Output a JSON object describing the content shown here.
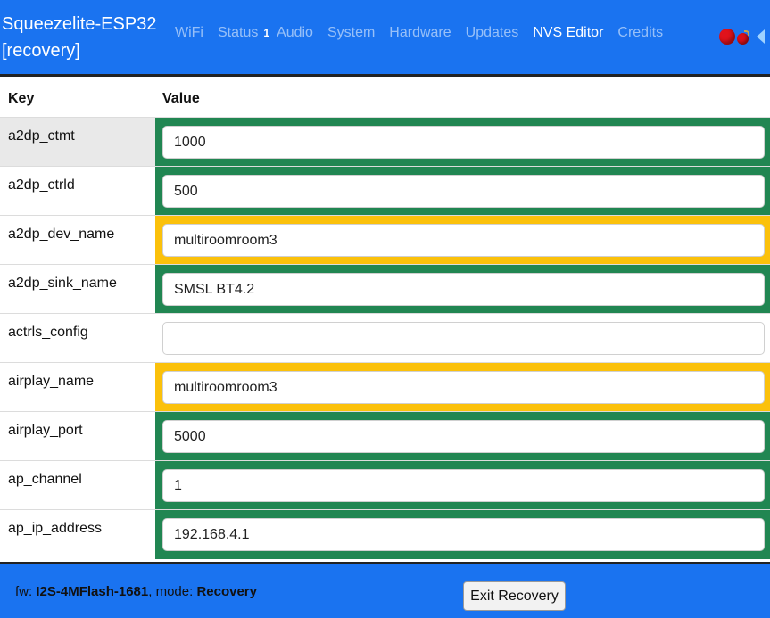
{
  "brand": {
    "line1": "Squeezelite-ESP32",
    "line2": "[recovery]"
  },
  "nav": {
    "wifi": "WiFi",
    "status": "Status",
    "status_badge": "1",
    "audio": "Audio",
    "system": "System",
    "hardware": "Hardware",
    "updates": "Updates",
    "nvs_editor": "NVS Editor",
    "credits": "Credits",
    "active": "NVS Editor"
  },
  "colors": {
    "navbar": "#1a73f0",
    "row_ok": "#218652",
    "row_warn": "#fbc10b",
    "status_red": "#e0121b"
  },
  "indicators": [
    "status-led-icon",
    "bomb-icon",
    "speaker-icon"
  ],
  "table": {
    "key_header": "Key",
    "value_header": "Value",
    "rows": [
      {
        "key": "a2dp_ctmt",
        "value": "1000",
        "state": "ok"
      },
      {
        "key": "a2dp_ctrld",
        "value": "500",
        "state": "ok"
      },
      {
        "key": "a2dp_dev_name",
        "value": "multiroomroom3",
        "state": "warn"
      },
      {
        "key": "a2dp_sink_name",
        "value": "SMSL BT4.2",
        "state": "ok"
      },
      {
        "key": "actrls_config",
        "value": "",
        "state": "none"
      },
      {
        "key": "airplay_name",
        "value": "multiroomroom3",
        "state": "warn"
      },
      {
        "key": "airplay_port",
        "value": "5000",
        "state": "ok"
      },
      {
        "key": "ap_channel",
        "value": "1",
        "state": "ok"
      },
      {
        "key": "ap_ip_address",
        "value": "192.168.4.1",
        "state": "ok"
      }
    ]
  },
  "footer": {
    "fw_label": "fw: ",
    "fw_value": "I2S-4MFlash-1681",
    "mode_label": ", mode: ",
    "mode_value": "Recovery",
    "exit_button": "Exit Recovery"
  }
}
